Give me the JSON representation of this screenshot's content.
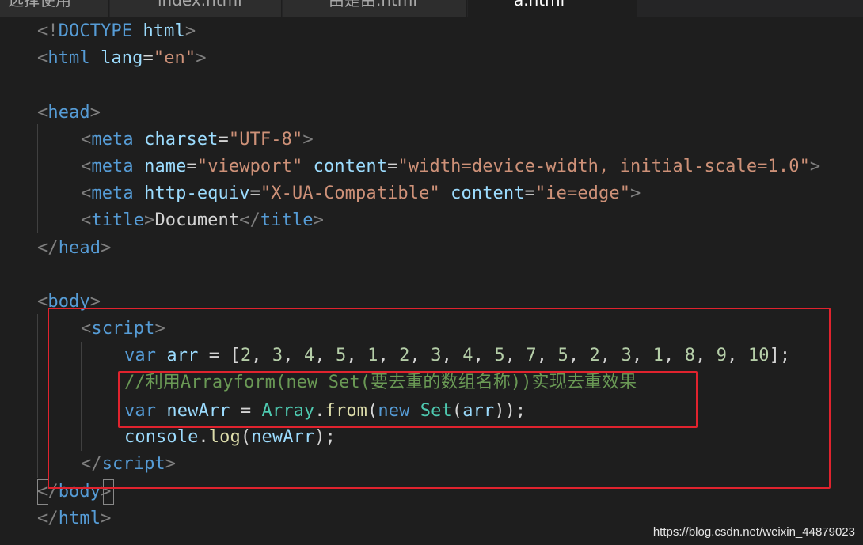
{
  "tabs": [
    {
      "label": "选择使用"
    },
    {
      "label": "index.html"
    },
    {
      "label": "由是由.html"
    },
    {
      "label": "a.html"
    }
  ],
  "code": {
    "l1": {
      "open": "<!",
      "tag": "DOCTYPE",
      "sp": " ",
      "attr": "html",
      "close": ">"
    },
    "l2": {
      "open": "<",
      "tag": "html",
      "sp": " ",
      "attr": "lang",
      "eq": "=",
      "val": "\"en\"",
      "close": ">"
    },
    "l4": {
      "open": "<",
      "tag": "head",
      "close": ">"
    },
    "l5": {
      "open": "<",
      "tag": "meta",
      "sp": " ",
      "attr": "charset",
      "eq": "=",
      "val": "\"UTF-8\"",
      "close": ">"
    },
    "l6": {
      "open": "<",
      "tag": "meta",
      "sp": " ",
      "attr1": "name",
      "eq1": "=",
      "val1": "\"viewport\"",
      "sp2": " ",
      "attr2": "content",
      "eq2": "=",
      "val2": "\"width=device-width, initial-scale=1.0\"",
      "close": ">"
    },
    "l7": {
      "open": "<",
      "tag": "meta",
      "sp": " ",
      "attr1": "http-equiv",
      "eq1": "=",
      "val1": "\"X-UA-Compatible\"",
      "sp2": " ",
      "attr2": "content",
      "eq2": "=",
      "val2": "\"ie=edge\"",
      "close": ">"
    },
    "l8": {
      "open": "<",
      "tag": "title",
      "close": ">",
      "text": "Document",
      "open2": "</",
      "tag2": "title",
      "close2": ">"
    },
    "l9": {
      "open": "</",
      "tag": "head",
      "close": ">"
    },
    "l11": {
      "open": "<",
      "tag": "body",
      "close": ">"
    },
    "l12": {
      "open": "<",
      "tag": "script",
      "close": ">"
    },
    "l13": {
      "kw": "var",
      "sp": " ",
      "name": "arr",
      "op": " = ",
      "lb": "[",
      "nums": [
        "2",
        "3",
        "4",
        "5",
        "1",
        "2",
        "3",
        "4",
        "5",
        "7",
        "5",
        "2",
        "3",
        "1",
        "8",
        "9",
        "10"
      ],
      "rb": "];"
    },
    "l14": {
      "comment_a": "//利用Arrayform(new Set(",
      "comment_b": "要去重的数组名称",
      "comment_c": "))",
      "comment_d": "实现去重效果"
    },
    "l15": {
      "kw": "var",
      "sp": " ",
      "name": "newArr",
      "op": " = ",
      "cls": "Array",
      "dot": ".",
      "fn": "from",
      "p1": "(",
      "kw2": "new",
      "sp2": " ",
      "cls2": "Set",
      "p2": "(",
      "arg": "arr",
      "p3": "));"
    },
    "l16": {
      "obj": "console",
      "dot": ".",
      "fn": "log",
      "p1": "(",
      "arg": "newArr",
      "p2": ");"
    },
    "l17": {
      "open": "</",
      "tag": "script",
      "close": ">"
    },
    "l18": {
      "open": "</",
      "tag": "body",
      "close": ">"
    },
    "l19": {
      "open": "</",
      "tag": "html",
      "close": ">"
    }
  },
  "watermark": "https://blog.csdn.net/weixin_44879023",
  "colors": {
    "background": "#1e1e1e",
    "tag": "#569cd6",
    "attribute": "#9cdcfe",
    "string": "#ce9178",
    "number": "#b5cea8",
    "comment": "#6a9955",
    "class": "#4ec9b0",
    "function": "#dcdcaa",
    "annotation_box": "#e0232e"
  }
}
